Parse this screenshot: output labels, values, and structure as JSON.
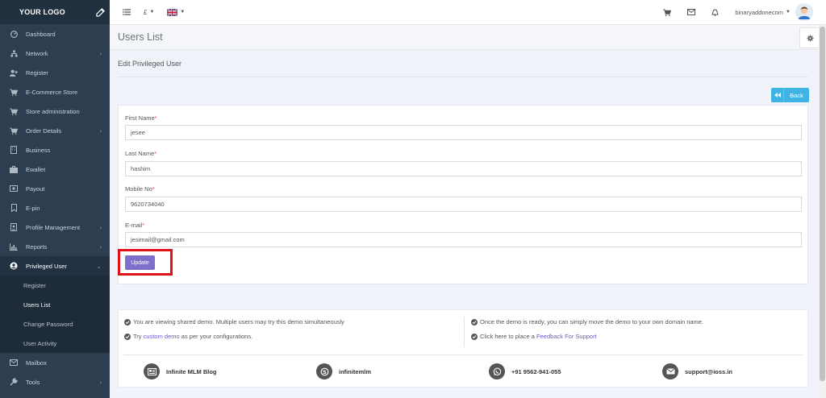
{
  "logo": "YOUR LOGO",
  "sidebar": {
    "items": [
      {
        "label": "Dashboard",
        "icon": "dashboard-icon"
      },
      {
        "label": "Network",
        "icon": "sitemap-icon",
        "chevron": "›"
      },
      {
        "label": "Register",
        "icon": "user-plus-icon"
      },
      {
        "label": "E-Commerce Store",
        "icon": "cart-icon"
      },
      {
        "label": "Store administration",
        "icon": "cart-icon"
      },
      {
        "label": "Order Details",
        "icon": "cart-icon",
        "chevron": "›"
      },
      {
        "label": "Business",
        "icon": "building-icon"
      },
      {
        "label": "Ewallet",
        "icon": "briefcase-icon"
      },
      {
        "label": "Payout",
        "icon": "money-icon"
      },
      {
        "label": "E-pin",
        "icon": "bookmark-icon"
      },
      {
        "label": "Profile Management",
        "icon": "id-card-icon",
        "chevron": "›"
      },
      {
        "label": "Reports",
        "icon": "bar-chart-icon",
        "chevron": "›"
      },
      {
        "label": "Privileged User",
        "icon": "user-circle-icon",
        "chevron": "⌄"
      }
    ],
    "subitems": [
      "Register",
      "Users List",
      "Change Password",
      "User Activity"
    ],
    "after": [
      {
        "label": "Mailbox",
        "icon": "mail-icon"
      },
      {
        "label": "Tools",
        "icon": "wrench-icon",
        "chevron": "›"
      }
    ]
  },
  "topbar": {
    "currency": "£",
    "username": "binaryaddonecom"
  },
  "page": {
    "title": "Users List",
    "section": "Edit Privileged User",
    "back_label": "Back"
  },
  "form": {
    "first_name_label": "First Name",
    "first_name_value": "jesee",
    "last_name_label": "Last Name",
    "last_name_value": "hashim",
    "mobile_label": "Mobile No",
    "mobile_value": "9620734040",
    "email_label": "E-mail",
    "email_value": "jesimail@gmail.com",
    "required_mark": "*",
    "update_label": "Update"
  },
  "footer": {
    "note1": "You are viewing shared demo. Multiple users may try this demo simultaneously",
    "note2_prefix": "Try",
    "note2_link": "custom demo",
    "note2_suffix": "as per your configurations.",
    "note3": "Once the demo is ready, you can simply move the demo to your own domain name.",
    "note4_prefix": "Click here to place a",
    "note4_link": "Feedback For Support",
    "contacts": {
      "blog": "Infinite MLM Blog",
      "skype": "infinitemlm",
      "phone": "+91 9562-941-055",
      "email": "support@ioss.in"
    }
  },
  "colors": {
    "sidebar_bg": "#2c3e50",
    "accent": "#7e6fcd",
    "back_btn": "#3fb4e4",
    "highlight": "#e2121a"
  }
}
